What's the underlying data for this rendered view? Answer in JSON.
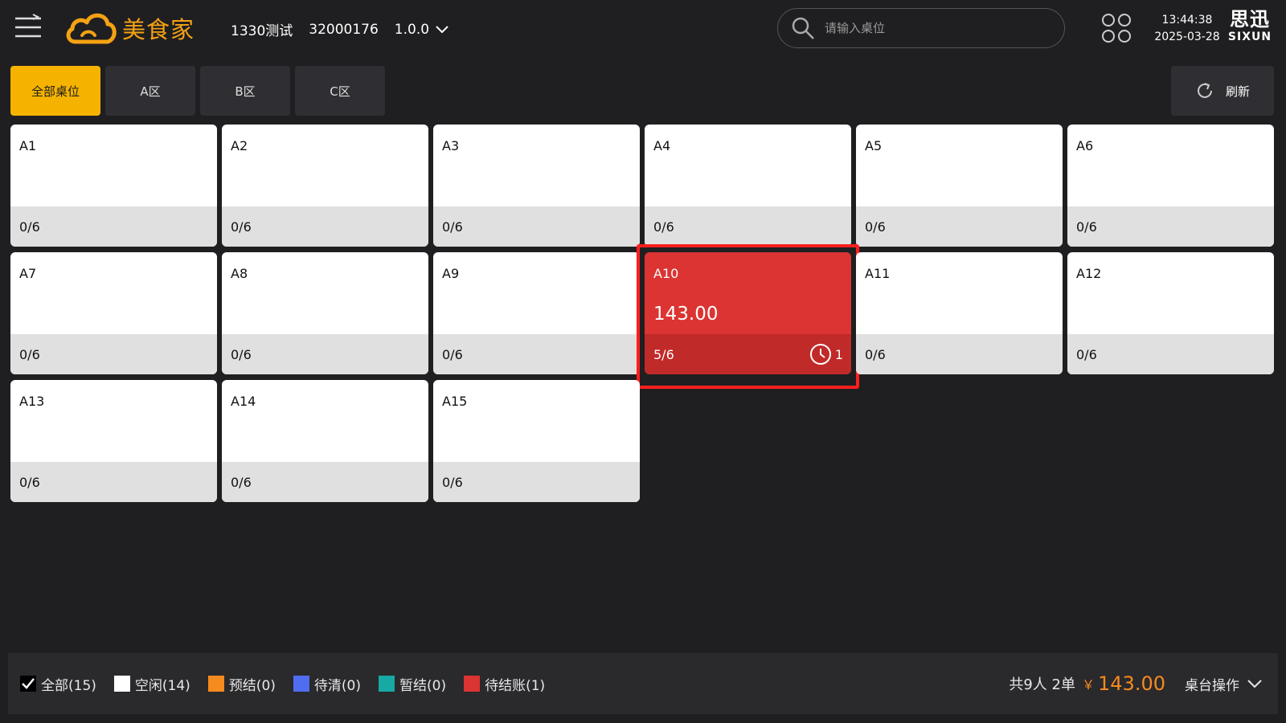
{
  "header": {
    "logo_text": "美食家",
    "store_name": "1330测试",
    "store_code": "32000176",
    "version": "1.0.0",
    "search_placeholder": "请输入桌位",
    "time": "13:44:38",
    "date": "2025-03-28",
    "brand_cn": "思迅",
    "brand_en": "SIXUN"
  },
  "tabs": [
    "全部桌位",
    "A区",
    "B区",
    "C区"
  ],
  "active_tab": "全部桌位",
  "refresh_label": "刷新",
  "tables": [
    {
      "name": "A1",
      "seats": "0/6"
    },
    {
      "name": "A2",
      "seats": "0/6"
    },
    {
      "name": "A3",
      "seats": "0/6"
    },
    {
      "name": "A4",
      "seats": "0/6"
    },
    {
      "name": "A5",
      "seats": "0/6"
    },
    {
      "name": "A6",
      "seats": "0/6"
    },
    {
      "name": "A7",
      "seats": "0/6"
    },
    {
      "name": "A8",
      "seats": "0/6"
    },
    {
      "name": "A9",
      "seats": "0/6"
    },
    {
      "name": "A10",
      "seats": "5/6",
      "amount": "143.00",
      "timer_count": "1",
      "status": "occupied",
      "highlighted": true
    },
    {
      "name": "A11",
      "seats": "0/6"
    },
    {
      "name": "A12",
      "seats": "0/6"
    },
    {
      "name": "A13",
      "seats": "0/6"
    },
    {
      "name": "A14",
      "seats": "0/6"
    },
    {
      "name": "A15",
      "seats": "0/6"
    }
  ],
  "legend": [
    {
      "label": "全部(15)",
      "color": "#000000",
      "checked": true
    },
    {
      "label": "空闲(14)",
      "color": "#ffffff"
    },
    {
      "label": "预结(0)",
      "color": "#f58a1f"
    },
    {
      "label": "待清(0)",
      "color": "#4f6df0"
    },
    {
      "label": "暂结(0)",
      "color": "#17a9a4"
    },
    {
      "label": "待结账(1)",
      "color": "#db3432"
    }
  ],
  "summary": {
    "counts": "共9人 2单",
    "currency": "￥",
    "total": "143.00",
    "ops_label": "桌台操作"
  },
  "colors": {
    "accent": "#f5b300",
    "brand": "#f5a213",
    "occupied": "#db3432",
    "highlight_border": "#ff1f1f"
  }
}
